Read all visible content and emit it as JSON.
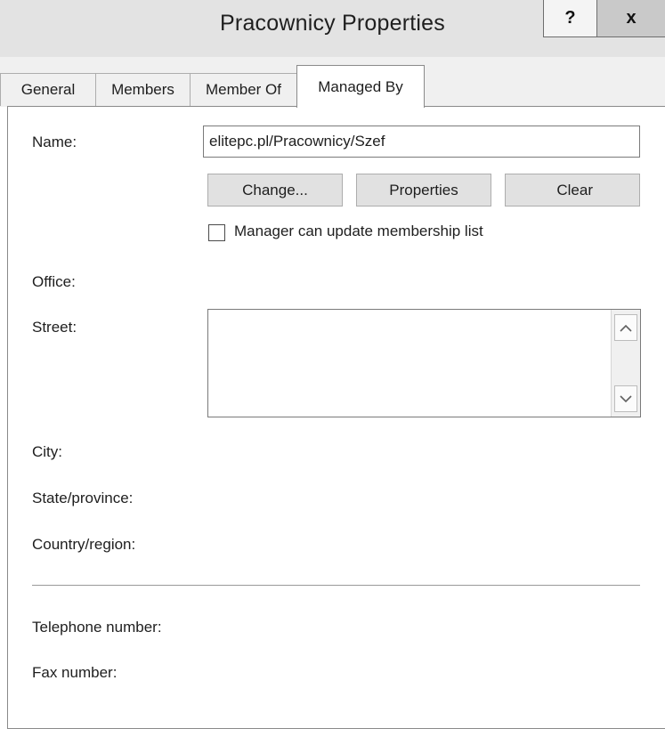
{
  "window": {
    "title": "Pracownicy Properties",
    "help_label": "?",
    "close_label": "x"
  },
  "tabs": [
    {
      "label": "General",
      "active": false
    },
    {
      "label": "Members",
      "active": false
    },
    {
      "label": "Member Of",
      "active": false
    },
    {
      "label": "Managed By",
      "active": true
    }
  ],
  "form": {
    "name_label": "Name:",
    "name_value": "elitepc.pl/Pracownicy/Szef",
    "buttons": {
      "change": "Change...",
      "properties": "Properties",
      "clear": "Clear"
    },
    "checkbox_label": "Manager can update membership list",
    "checkbox_checked": false,
    "office_label": "Office:",
    "street_label": "Street:",
    "street_value": "",
    "city_label": "City:",
    "state_label": "State/province:",
    "country_label": "Country/region:",
    "telephone_label": "Telephone number:",
    "fax_label": "Fax number:"
  },
  "icons": {
    "scroll_up": "chevron-up-icon",
    "scroll_down": "chevron-down-icon"
  }
}
